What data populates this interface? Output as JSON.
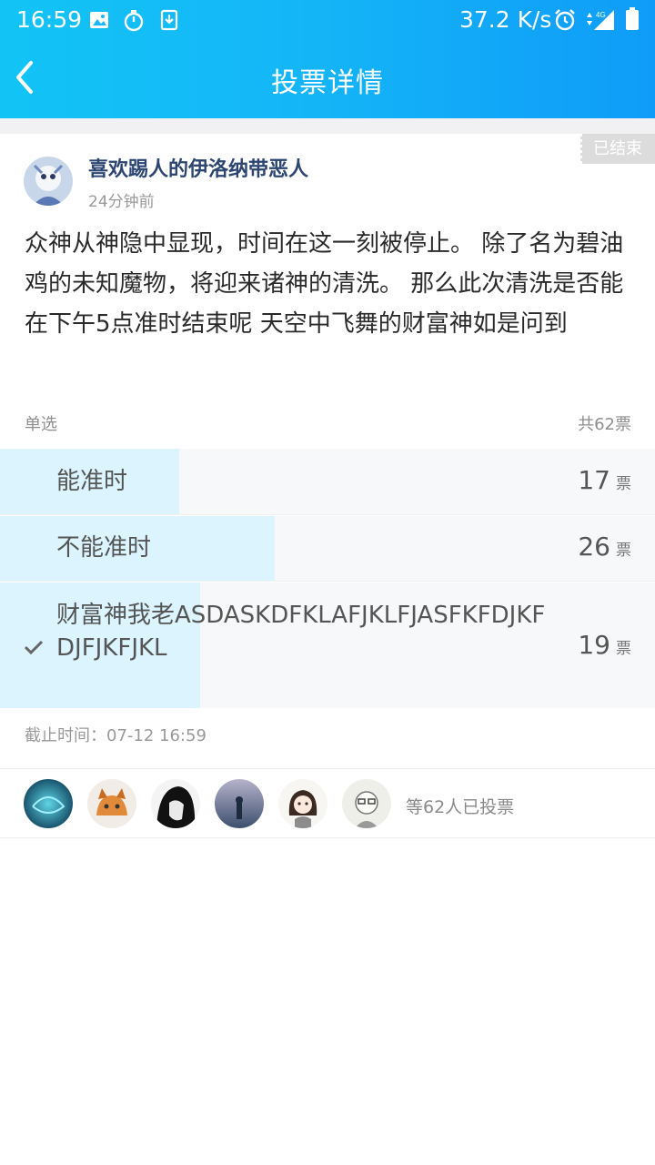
{
  "status_bar": {
    "time": "16:59",
    "speed": "37.2 K/s",
    "network": "4G",
    "icons": [
      "image-icon",
      "stopwatch-icon",
      "download-icon",
      "alarm-icon",
      "signal-icon",
      "battery-icon"
    ]
  },
  "header": {
    "title": "投票详情",
    "back_icon": "chevron-left-icon",
    "gradient": [
      "#12c4f6",
      "#0f9cf8"
    ]
  },
  "post": {
    "badge": "已结束",
    "author": "喜欢踢人的伊洛纳带恶人",
    "time_ago": "24分钟前",
    "content": "众神从神隐中显现，时间在这一刻被停止。 除了名为碧油鸡的未知魔物，将迎来诸神的清洗。 那么此次清洗是否能在下午5点准时结束呢 天空中飞舞的财富神如是问到"
  },
  "poll": {
    "mode": "单选",
    "total": "共62票",
    "vote_unit": "票",
    "options": [
      {
        "label": "能准时",
        "votes": "17",
        "share": 0.274,
        "selected": false
      },
      {
        "label": "不能准时",
        "votes": "26",
        "share": 0.419,
        "selected": false
      },
      {
        "label": "财富神我老ASDASKDFKLAFJKLFJASFKFDJKFDJFJKFJKL",
        "votes": "19",
        "share": 0.306,
        "selected": true
      }
    ],
    "deadline": "截止时间：07-12 16:59"
  },
  "voters": {
    "summary": "等62人已投票",
    "avatars": [
      "avatar-1",
      "avatar-2",
      "avatar-3",
      "avatar-4",
      "avatar-5",
      "avatar-6"
    ]
  },
  "colors": {
    "accent": "#14b6f7",
    "fill": "#dbf4fd",
    "author": "#2c4572"
  }
}
